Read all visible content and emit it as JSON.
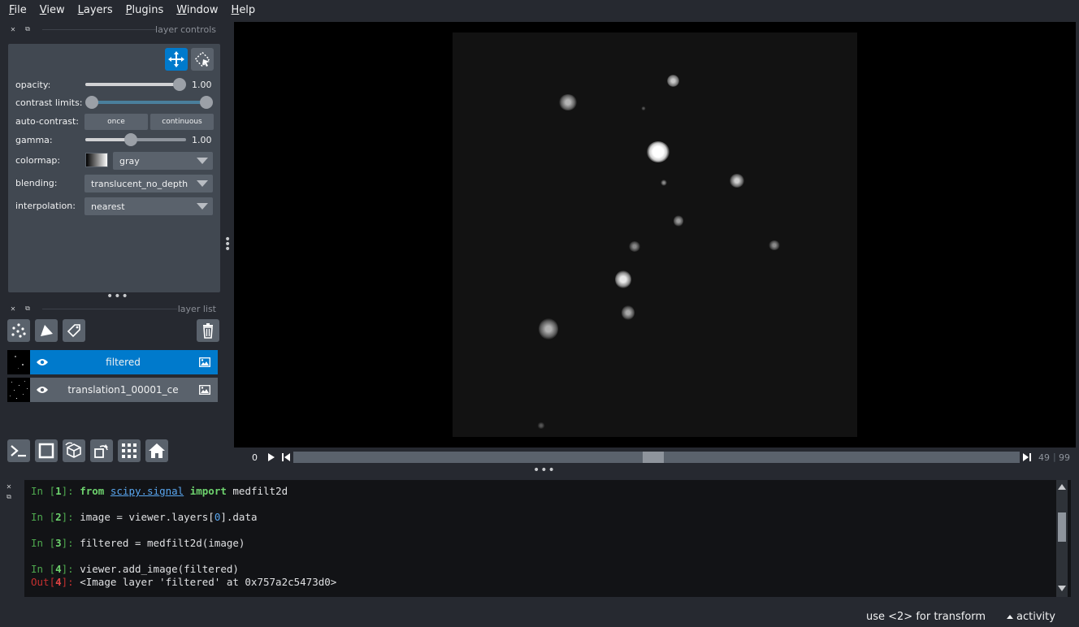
{
  "menu": [
    "File",
    "View",
    "Layers",
    "Plugins",
    "Window",
    "Help"
  ],
  "layer_controls": {
    "dock_title": "layer controls",
    "opacity_label": "opacity:",
    "opacity_value": "1.00",
    "opacity_level": 1.0,
    "contrast_label": "contrast limits:",
    "contrast_range": [
      0.0,
      1.0
    ],
    "auto_contrast_label": "auto-contrast:",
    "once_label": "once",
    "continuous_label": "continuous",
    "gamma_label": "gamma:",
    "gamma_value": "1.00",
    "gamma_level": 0.45,
    "colormap_label": "colormap:",
    "colormap_value": "gray",
    "blending_label": "blending:",
    "blending_value": "translucent_no_depth",
    "interpolation_label": "interpolation:",
    "interpolation_value": "nearest"
  },
  "layer_list": {
    "dock_title": "layer list",
    "layers": [
      {
        "name": "filtered",
        "selected": true
      },
      {
        "name": "translation1_00001_ce",
        "selected": false
      }
    ]
  },
  "dims": {
    "start": "0",
    "current": "49",
    "max": "99"
  },
  "console": {
    "lines": [
      {
        "n": "1",
        "code_kw1": "from",
        "code_mod": "scipy.signal",
        "code_kw2": "import",
        "code_rest": "medfilt2d"
      },
      {
        "n": "2",
        "code_a": "image = viewer.layers[",
        "code_num": "0",
        "code_b": "].data"
      },
      {
        "n": "3",
        "code": "filtered = medfilt2d(image)"
      },
      {
        "n": "4",
        "code": "viewer.add_image(filtered)"
      }
    ],
    "out_n": "4",
    "out_text": "<Image layer 'filtered' at 0x757a2c5473d0>",
    "in_label": "In",
    "out_label": "Out"
  },
  "status": {
    "hint": "use <2> for transform",
    "activity": "activity"
  },
  "colors": {
    "accent": "#007acc",
    "background": "#262930",
    "panel": "#414851",
    "button": "#5a626c"
  }
}
